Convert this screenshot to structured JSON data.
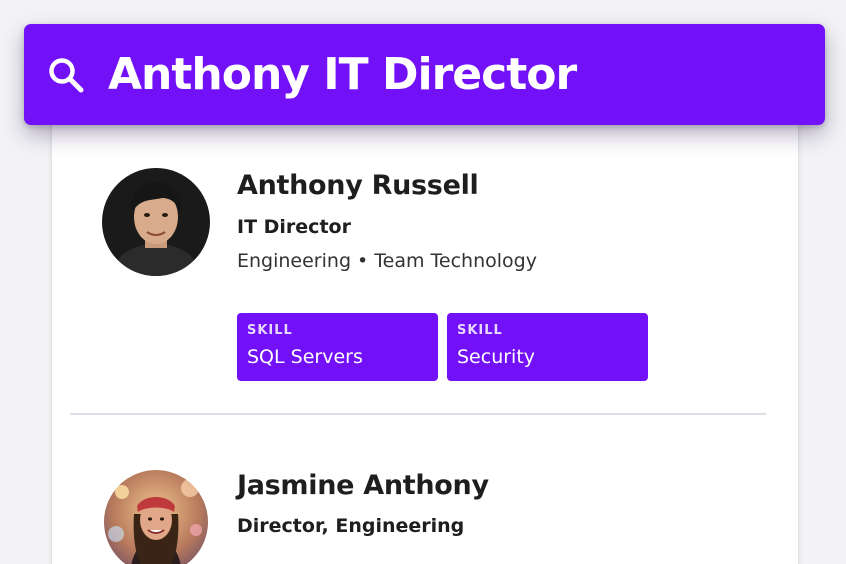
{
  "search": {
    "query": "Anthony IT Director",
    "icon": "search-icon"
  },
  "colors": {
    "accent": "#7210F7",
    "text": "#1E1E1E",
    "divider": "#DEDEE6"
  },
  "results": [
    {
      "name": "Anthony Russell",
      "title": "IT Director",
      "org": "Engineering • Team Technology",
      "skills": [
        {
          "label": "SKILL",
          "value": "SQL Servers"
        },
        {
          "label": "SKILL",
          "value": "Security"
        }
      ]
    },
    {
      "name": "Jasmine Anthony",
      "title": "Director, Engineering"
    }
  ]
}
